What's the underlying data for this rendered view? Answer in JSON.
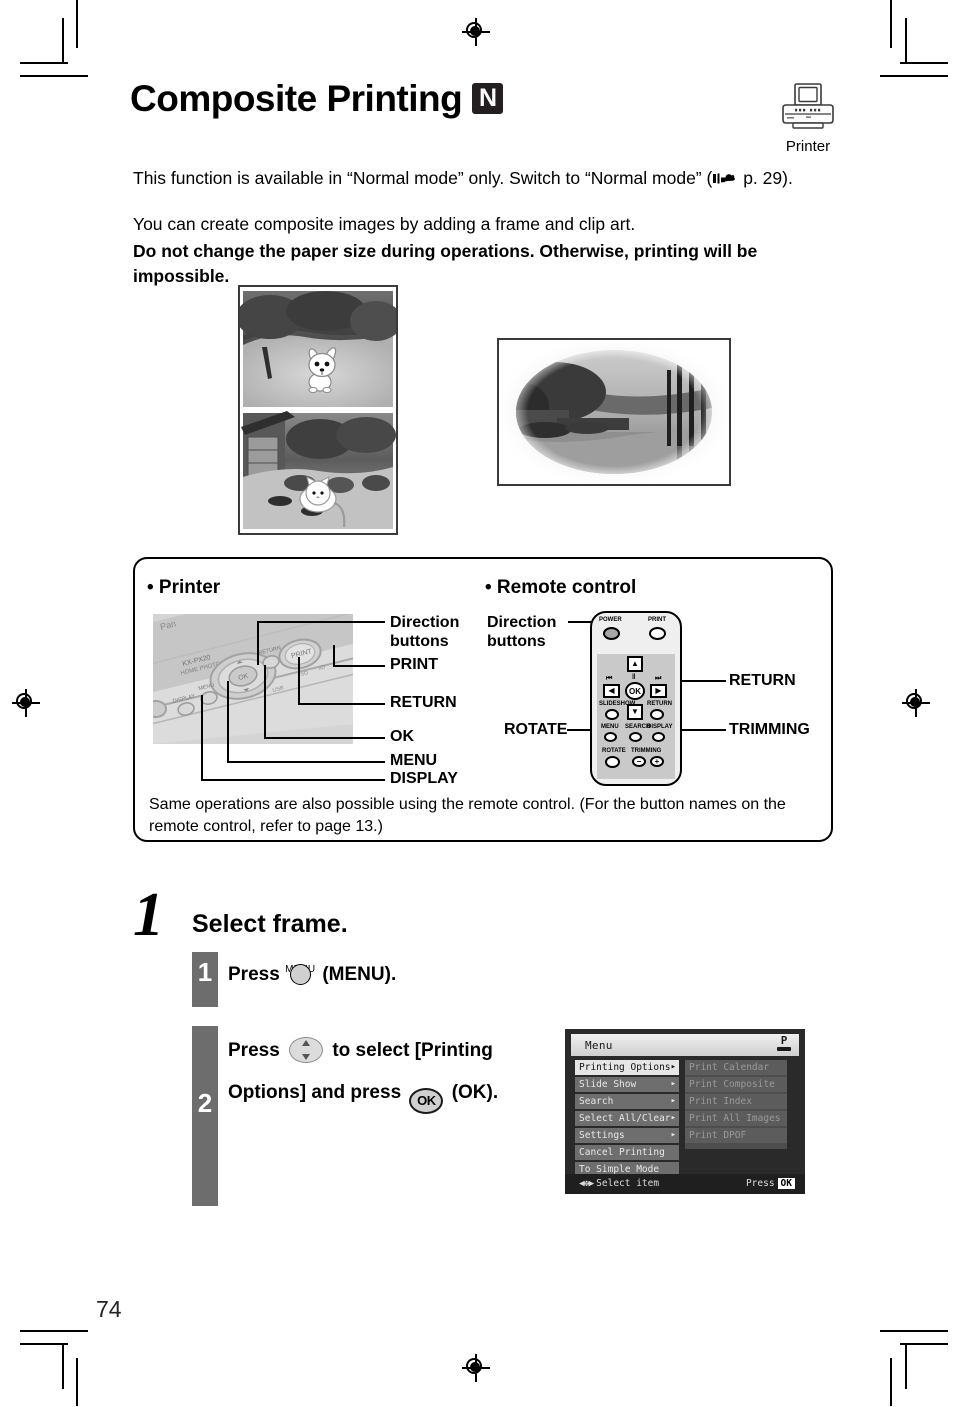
{
  "document": {
    "page_number": "74"
  },
  "header": {
    "title": "Composite Printing",
    "mode_badge": "N",
    "device_icon_caption": "Printer",
    "device_icon_name": "printer-icon"
  },
  "intro": {
    "line1_before": "This function is available in “Normal mode” only. Switch to “Normal mode” (",
    "hand_icon": "pointing-hand-icon",
    "line1_after": " p. 29).",
    "line2": "You can create composite images by adding a frame and clip art.",
    "line2_bold": "Do not change the paper size during operations. Otherwise, printing will be impossible."
  },
  "samples": {
    "left_caption": "composite-sample-clipart",
    "right_caption": "composite-sample-frame"
  },
  "callout": {
    "printer_heading": "• Printer",
    "remote_heading": "• Remote control",
    "note": "Same operations are also possible using the remote control. (For the button names on the remote control, refer to page 13.)",
    "printer_labels": [
      "Direction buttons",
      "PRINT",
      "RETURN",
      "OK",
      "MENU",
      "DISPLAY"
    ],
    "printer_label_lines": {
      "direction_l1": "Direction",
      "direction_l2": "buttons",
      "print": "PRINT",
      "return": "RETURN",
      "ok": "OK",
      "menu": "MENU",
      "display": "DISPLAY"
    },
    "remote_label_lines": {
      "direction_l1": "Direction",
      "direction_l2": "buttons",
      "return": "RETURN",
      "rotate": "ROTATE",
      "trimming": "TRIMMING"
    },
    "remote_buttons": {
      "power": "POWER",
      "print": "PRINT",
      "prev": "⏮",
      "pause": "‖",
      "next": "⏭",
      "left": "◀",
      "ok": "OK",
      "right": "▶",
      "up": "▲",
      "down": "▼",
      "slideshow": "SLIDESHOW",
      "return": "RETURN",
      "menu": "MENU",
      "search": "SEARCH",
      "display": "DISPLAY",
      "rotate": "ROTATE",
      "trimming": "TRIMMING",
      "trim_minus": "−",
      "trim_plus": "+"
    }
  },
  "step": {
    "number": "1",
    "title": "Select frame.",
    "substeps": [
      {
        "number": "1",
        "press_word": "Press",
        "button_tag": "MENU",
        "button_name": "menu-button",
        "tail": "(MENU)."
      },
      {
        "number": "2",
        "press_word": "Press",
        "button_name": "direction-button",
        "mid": "to select [Printing",
        "line2_start": "Options] and press",
        "ok_label": "OK",
        "tail": "(OK)."
      }
    ]
  },
  "lcd": {
    "title": "Menu",
    "status_icon": "paper-status-icon",
    "status_letter": "P",
    "left_items": [
      {
        "label": "Printing Options",
        "arrow": "▸",
        "selected": true
      },
      {
        "label": "Slide Show",
        "arrow": "▸",
        "selected": false
      },
      {
        "label": "Search",
        "arrow": "▸",
        "selected": false
      },
      {
        "label": "Select All/Clear",
        "arrow": "▸",
        "selected": false
      },
      {
        "label": "Settings",
        "arrow": "▸",
        "selected": false
      },
      {
        "label": "Cancel Printing",
        "arrow": "",
        "selected": false
      },
      {
        "label": "To Simple Mode",
        "arrow": "",
        "selected": false
      }
    ],
    "right_items": [
      {
        "label": "Print Calendar"
      },
      {
        "label": "Print Composite"
      },
      {
        "label": "Print Index"
      },
      {
        "label": "Print All Images"
      },
      {
        "label": "Print DPOF"
      }
    ],
    "footer": {
      "dpad_icon": "◀✥▶",
      "left_text": "Select item",
      "right_text": "Press",
      "ok_text": "OK"
    }
  }
}
